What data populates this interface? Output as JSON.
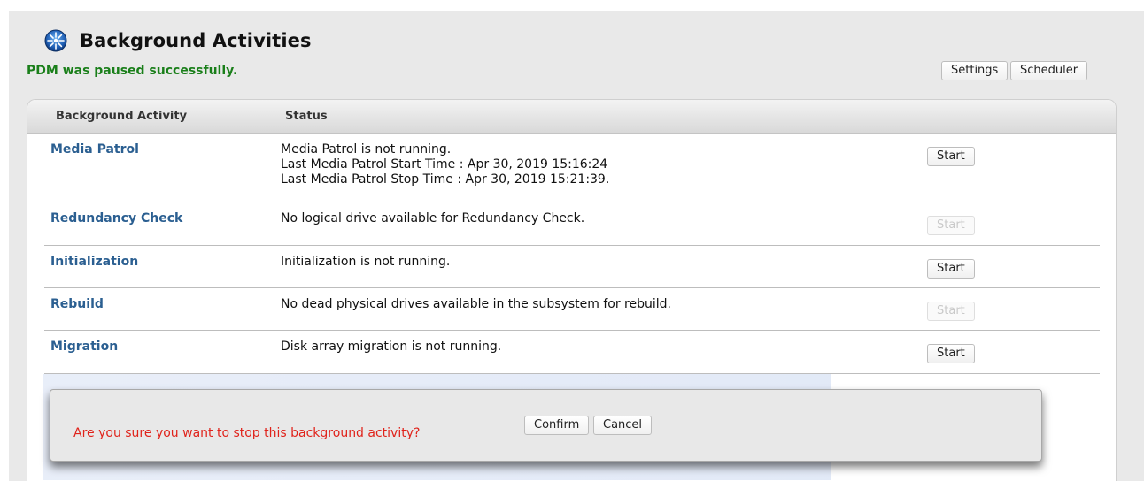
{
  "header": {
    "title": "Background Activities",
    "icon": "compass-icon"
  },
  "status_message": "PDM was paused successfully.",
  "toolbar": {
    "settings_label": "Settings",
    "scheduler_label": "Scheduler"
  },
  "table": {
    "columns": [
      "Background Activity",
      "Status"
    ],
    "rows": [
      {
        "name": "Media Patrol",
        "status_lines": [
          "Media Patrol is not running.",
          "Last Media Patrol Start Time : Apr 30, 2019 15:16:24",
          "Last Media Patrol Stop Time : Apr 30, 2019 15:21:39."
        ],
        "button_label": "Start",
        "button_enabled": true
      },
      {
        "name": "Redundancy Check",
        "status_lines": [
          "No logical drive available for Redundancy Check."
        ],
        "button_label": "Start",
        "button_enabled": false
      },
      {
        "name": "Initialization",
        "status_lines": [
          "Initialization is not running."
        ],
        "button_label": "Start",
        "button_enabled": true
      },
      {
        "name": "Rebuild",
        "status_lines": [
          "No dead physical drives available in the subsystem for rebuild."
        ],
        "button_label": "Start",
        "button_enabled": false
      },
      {
        "name": "Migration",
        "status_lines": [
          "Disk array migration is not running."
        ],
        "button_label": "Start",
        "button_enabled": true
      }
    ]
  },
  "dialog": {
    "message": "Are you sure you want to stop this background activity?",
    "confirm_label": "Confirm",
    "cancel_label": "Cancel"
  },
  "colors": {
    "success": "#1a7f1a",
    "link": "#2b5f91",
    "warning": "#e0231b"
  }
}
